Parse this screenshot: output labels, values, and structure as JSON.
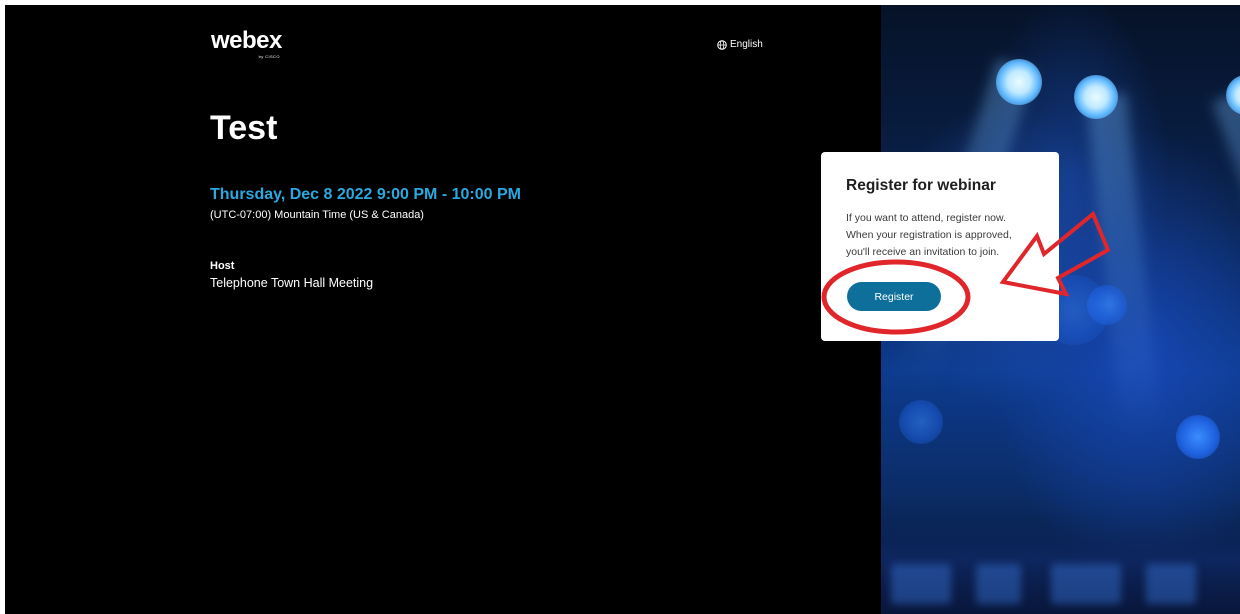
{
  "header": {
    "logo_text": "webex",
    "logo_sub": "by CISCO",
    "language_label": "English",
    "language_icon": "globe-icon"
  },
  "event": {
    "title": "Test",
    "datetime": "Thursday, Dec 8 2022 9:00 PM - 10:00 PM",
    "timezone": "(UTC-07:00) Mountain Time (US & Canada)",
    "host_label": "Host",
    "host_name": "Telephone Town Hall Meeting"
  },
  "register_card": {
    "heading": "Register for webinar",
    "description": "If you want to attend, register now. When your registration is approved, you'll receive an invitation to join.",
    "button_label": "Register"
  },
  "colors": {
    "background": "#000000",
    "accent_datetime": "#2aa8e0",
    "button": "#0e6f9a",
    "annotation": "#e0262b"
  }
}
